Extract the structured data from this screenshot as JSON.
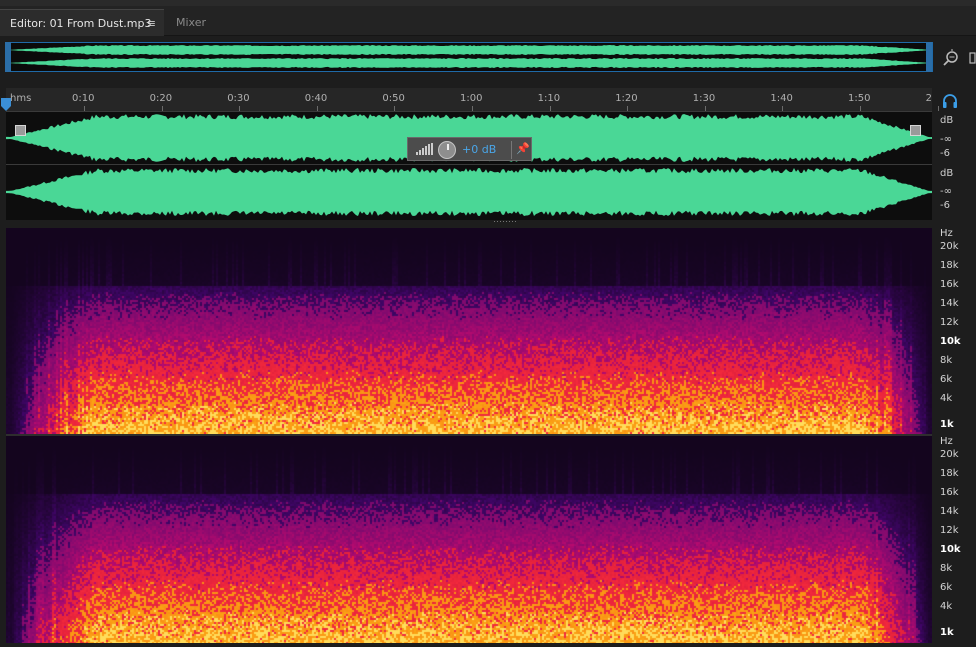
{
  "tabs": {
    "editor_label": "Editor: 01 From Dust.mp3",
    "mixer_label": "Mixer",
    "menu_icon": "hamburger-menu-icon"
  },
  "colors": {
    "waveform": "#4ad796",
    "accent": "#3b9ee8",
    "background": "#1d1d1d"
  },
  "timeline": {
    "unit_label": "hms",
    "ticks": [
      "0:10",
      "0:20",
      "0:30",
      "0:40",
      "0:50",
      "1:00",
      "1:10",
      "1:20",
      "1:30",
      "1:40",
      "1:50",
      "2"
    ]
  },
  "hud": {
    "volume": "+0 dB"
  },
  "amplitude_scale": {
    "channel_1": [
      "dB",
      "-∞",
      "-6"
    ],
    "channel_2": [
      "dB",
      "-∞",
      "-6"
    ]
  },
  "frequency_scale": {
    "channel_1": [
      "Hz",
      "20k",
      "18k",
      "16k",
      "14k",
      "12k",
      "10k",
      "8k",
      "6k",
      "4k",
      "1k"
    ],
    "channel_2": [
      "Hz",
      "20k",
      "18k",
      "16k",
      "14k",
      "12k",
      "10k",
      "8k",
      "6k",
      "4k",
      "1k"
    ]
  }
}
